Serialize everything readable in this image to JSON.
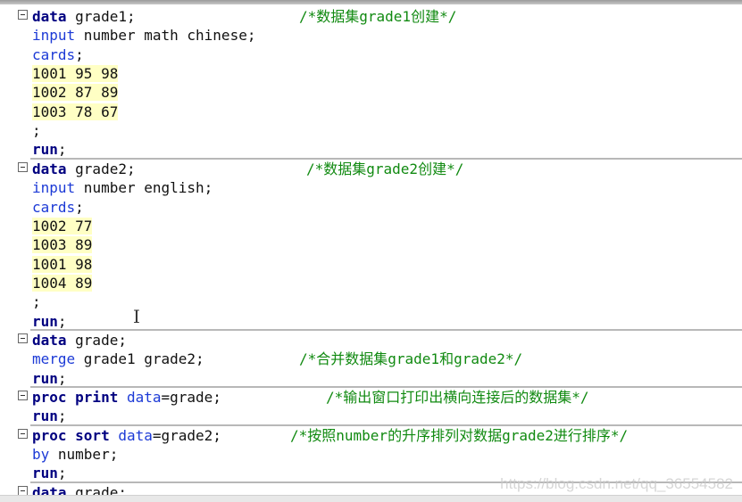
{
  "editor": {
    "lines": [
      {
        "fold": true,
        "tokens": [
          {
            "t": "data",
            "c": "kw"
          },
          {
            "t": " grade1;",
            "c": "tx"
          }
        ],
        "comment": "/*数据集grade1创建*/"
      },
      {
        "tokens": [
          {
            "t": "input",
            "c": "bk"
          },
          {
            "t": " number math chinese;",
            "c": "tx"
          }
        ]
      },
      {
        "tokens": [
          {
            "t": "cards",
            "c": "bk"
          },
          {
            "t": ";",
            "c": "tx"
          }
        ]
      },
      {
        "tokens": [
          {
            "t": "1001 95 98",
            "c": "dl"
          }
        ]
      },
      {
        "tokens": [
          {
            "t": "1002 87 89",
            "c": "dl"
          }
        ]
      },
      {
        "tokens": [
          {
            "t": "1003 78 67",
            "c": "dl"
          }
        ]
      },
      {
        "tokens": [
          {
            "t": ";",
            "c": "tx"
          }
        ]
      },
      {
        "tokens": [
          {
            "t": "run",
            "c": "kw"
          },
          {
            "t": ";",
            "c": "tx"
          }
        ]
      },
      {
        "fold": true,
        "sep": true,
        "tokens": [
          {
            "t": "data",
            "c": "kw"
          },
          {
            "t": " grade2;",
            "c": "tx"
          }
        ],
        "comment": "/*数据集grade2创建*/"
      },
      {
        "tokens": [
          {
            "t": "input",
            "c": "bk"
          },
          {
            "t": " number english;",
            "c": "tx"
          }
        ]
      },
      {
        "tokens": [
          {
            "t": "cards",
            "c": "bk"
          },
          {
            "t": ";",
            "c": "tx"
          }
        ]
      },
      {
        "tokens": [
          {
            "t": "1002 77",
            "c": "dl"
          }
        ]
      },
      {
        "tokens": [
          {
            "t": "1003 89",
            "c": "dl"
          }
        ]
      },
      {
        "tokens": [
          {
            "t": "1001 98",
            "c": "dl"
          }
        ]
      },
      {
        "tokens": [
          {
            "t": "1004 89",
            "c": "dl"
          }
        ]
      },
      {
        "tokens": [
          {
            "t": ";",
            "c": "tx"
          }
        ]
      },
      {
        "tokens": [
          {
            "t": "run",
            "c": "kw"
          },
          {
            "t": ";",
            "c": "tx"
          }
        ]
      },
      {
        "fold": true,
        "sep": true,
        "tokens": [
          {
            "t": "data",
            "c": "kw"
          },
          {
            "t": " grade;",
            "c": "tx"
          }
        ]
      },
      {
        "tokens": [
          {
            "t": "merge",
            "c": "bk"
          },
          {
            "t": " grade1 grade2;",
            "c": "tx"
          }
        ],
        "comment": "/*合并数据集grade1和grade2*/"
      },
      {
        "tokens": [
          {
            "t": "run",
            "c": "kw"
          },
          {
            "t": ";",
            "c": "tx"
          }
        ]
      },
      {
        "fold": true,
        "sep": true,
        "tokens": [
          {
            "t": "proc print",
            "c": "kw"
          },
          {
            "t": " ",
            "c": "tx"
          },
          {
            "t": "data",
            "c": "bk"
          },
          {
            "t": "=grade;",
            "c": "tx"
          }
        ],
        "comment": "/*输出窗口打印出横向连接后的数据集*/"
      },
      {
        "tokens": [
          {
            "t": "run",
            "c": "kw"
          },
          {
            "t": ";",
            "c": "tx"
          }
        ]
      },
      {
        "fold": true,
        "sep": true,
        "tokens": [
          {
            "t": "proc sort",
            "c": "kw"
          },
          {
            "t": " ",
            "c": "tx"
          },
          {
            "t": "data",
            "c": "bk"
          },
          {
            "t": "=grade2;",
            "c": "tx"
          }
        ],
        "comment": "/*按照number的升序排列对数据grade2进行排序*/"
      },
      {
        "tokens": [
          {
            "t": "by",
            "c": "bk"
          },
          {
            "t": " number;",
            "c": "tx"
          }
        ]
      },
      {
        "tokens": [
          {
            "t": "run",
            "c": "kw"
          },
          {
            "t": ";",
            "c": "tx"
          }
        ]
      },
      {
        "fold": true,
        "sep": true,
        "tokens": [
          {
            "t": "data",
            "c": "kw"
          },
          {
            "t": " grade;",
            "c": "tx"
          }
        ]
      }
    ]
  },
  "watermark": "https://blog.csdn.net/qq_36554582",
  "colors": {
    "keyword": "#000080",
    "statement": "#1c3ad6",
    "comment": "#118a11",
    "datalines_bg": "#ffffc4"
  }
}
